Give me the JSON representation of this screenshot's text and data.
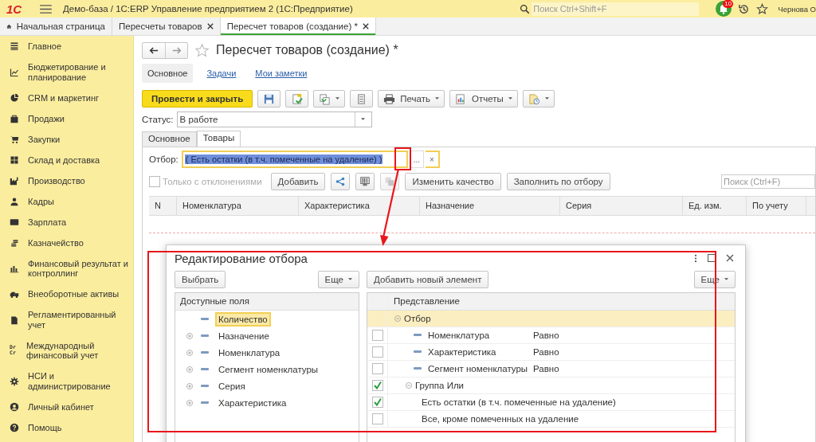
{
  "app_bar": {
    "logo": "1С",
    "title": "Демо-база / 1С:ERP Управление предприятием 2  (1С:Предприятие)",
    "search": {
      "placeholder": "Поиск Ctrl+Shift+F"
    },
    "notifications": "10",
    "user": "Чернова О"
  },
  "open_tabs": [
    {
      "label": "Начальная страница",
      "kind": "home",
      "selected": false
    },
    {
      "label": "Пересчеты товаров",
      "kind": "document",
      "selected": false
    },
    {
      "label": "Пересчет товаров (создание) *",
      "kind": "document",
      "selected": true
    }
  ],
  "sidebar": {
    "items": [
      {
        "label": "Главное"
      },
      {
        "label": "Бюджетирование и планирование"
      },
      {
        "label": "CRM и маркетинг"
      },
      {
        "label": "Продажи"
      },
      {
        "label": "Закупки"
      },
      {
        "label": "Склад и доставка"
      },
      {
        "label": "Производство"
      },
      {
        "label": "Кадры"
      },
      {
        "label": "Зарплата"
      },
      {
        "label": "Казначейство"
      },
      {
        "label": "Финансовый результат и контроллинг"
      },
      {
        "label": "Внеоборотные активы"
      },
      {
        "label": "Регламентированный учет"
      },
      {
        "label": "Международный финансовый учет",
        "icon_text": [
          "Dr",
          "Cr"
        ]
      },
      {
        "label": "НСИ и администрирование"
      },
      {
        "label": "Личный кабинет"
      },
      {
        "label": "Помощь"
      }
    ]
  },
  "form": {
    "title": "Пересчет товаров (создание) *",
    "sections": [
      {
        "label": "Основное",
        "selected": true
      },
      {
        "label": "Задачи",
        "selected": false
      },
      {
        "label": "Мои заметки",
        "selected": false
      }
    ],
    "toolbar": [
      {
        "kind": "primary",
        "label": "Провести и закрыть"
      },
      {
        "kind": "icon",
        "menu": false
      },
      {
        "kind": "icon",
        "menu": false
      },
      {
        "kind": "icon",
        "menu": true
      },
      {
        "kind": "icon",
        "menu": false
      },
      {
        "kind": "labeled",
        "label": "Печать",
        "menu": true
      },
      {
        "kind": "labeled",
        "label": "Отчеты",
        "menu": true
      },
      {
        "kind": "icon",
        "menu": true
      }
    ],
    "status": {
      "label": "Статус:",
      "value": "В работе"
    },
    "tabs": [
      {
        "label": "Основное",
        "selected": false
      },
      {
        "label": "Товары",
        "selected": true
      }
    ],
    "filter": {
      "label": "Отбор:",
      "value": "( Есть остатки (в т.ч. помеченные на удаление) )",
      "text_selected": true,
      "choose_button": "...",
      "clear_button": "×"
    },
    "table_toolbar": {
      "deviations": {
        "label": "Только с отклонениями",
        "checked": false,
        "disabled": true
      },
      "buttons": [
        {
          "kind": "text",
          "label": "Добавить",
          "disabled": false
        },
        {
          "kind": "icon",
          "disabled": false
        },
        {
          "kind": "icon",
          "disabled": false
        },
        {
          "kind": "icon",
          "disabled": true
        },
        {
          "kind": "text",
          "label": "Изменить качество",
          "disabled": false
        },
        {
          "kind": "text",
          "label": "Заполнить по отбору",
          "disabled": false
        }
      ],
      "search": {
        "placeholder": "Поиск (Ctrl+F)"
      }
    },
    "table": {
      "columns": [
        "N",
        "Номенклатура",
        "Характеристика",
        "Назначение",
        "Серия",
        "Ед. изм.",
        "По учету"
      ]
    }
  },
  "dialog": {
    "title": "Редактирование отбора",
    "left_buttons": [
      {
        "label": "Выбрать",
        "menu": false
      },
      {
        "label": "Еще",
        "menu": true
      }
    ],
    "right_buttons": [
      {
        "label": "Добавить новый элемент",
        "menu": false
      },
      {
        "label": "Еще",
        "menu": true
      }
    ],
    "available_fields": {
      "header": "Доступные поля",
      "items": [
        {
          "label": "Количество",
          "expandable": false,
          "selected": true
        },
        {
          "label": "Назначение",
          "expandable": true,
          "selected": false
        },
        {
          "label": "Номенклатура",
          "expandable": true,
          "selected": false
        },
        {
          "label": "Сегмент номенклатуры",
          "expandable": true,
          "selected": false
        },
        {
          "label": "Серия",
          "expandable": true,
          "selected": false
        },
        {
          "label": "Характеристика",
          "expandable": true,
          "selected": false
        }
      ]
    },
    "conditions": {
      "header": "Представление",
      "items": [
        {
          "kind": "root",
          "label": "Отбор",
          "expanded": true,
          "selected": true,
          "children": [
            {
              "kind": "field",
              "label": "Номенклатура",
              "condition": "Равно",
              "checked": false,
              "selected": false
            },
            {
              "kind": "field",
              "label": "Характеристика",
              "condition": "Равно",
              "checked": false,
              "selected": false
            },
            {
              "kind": "field",
              "label": "Сегмент номенклатуры",
              "condition": "Равно",
              "checked": false,
              "selected": false
            },
            {
              "kind": "group",
              "label": "Группа Или",
              "expanded": true,
              "checked": true,
              "selected": false,
              "children": [
                {
                  "kind": "preset",
                  "label": "Есть остатки (в т.ч. помеченные на удаление)",
                  "checked": true,
                  "selected": false
                },
                {
                  "kind": "preset",
                  "label": "Все, кроме помеченных на удаление",
                  "checked": false,
                  "selected": false
                }
              ]
            }
          ]
        }
      ]
    }
  }
}
